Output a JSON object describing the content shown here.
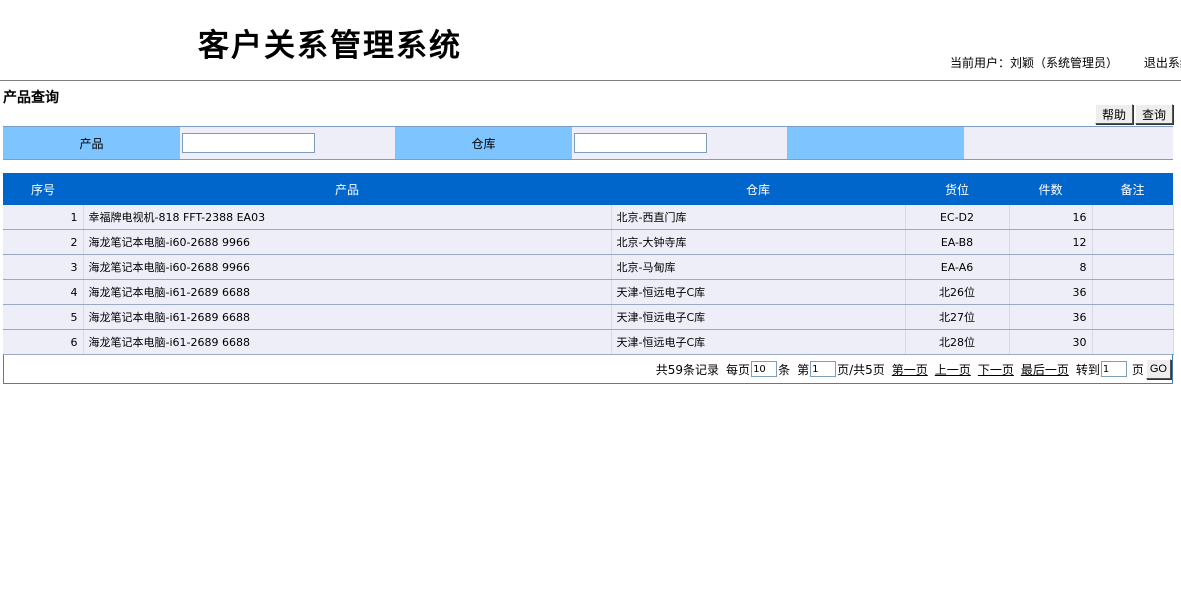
{
  "app": {
    "title": "客户关系管理系统",
    "current_user": "当前用户：刘颖（系统管理员）",
    "logout": "退出系统"
  },
  "page": {
    "title": "产品查询"
  },
  "toolbar": {
    "help_label": "帮助",
    "query_label": "查询"
  },
  "search": {
    "product_label": "产品",
    "product_value": "",
    "warehouse_label": "仓库",
    "warehouse_value": ""
  },
  "table": {
    "headers": [
      "序号",
      "产品",
      "仓库",
      "货位",
      "件数",
      "备注"
    ],
    "rows": [
      [
        "1",
        "幸福牌电视机-818 FFT-2388 EA03",
        "北京-西直门库",
        "EC-D2",
        "16",
        ""
      ],
      [
        "2",
        "海龙笔记本电脑-i60-2688 9966",
        "北京-大钟寺库",
        "EA-B8",
        "12",
        ""
      ],
      [
        "3",
        "海龙笔记本电脑-i60-2688 9966",
        "北京-马甸库",
        "EA-A6",
        "8",
        ""
      ],
      [
        "4",
        "海龙笔记本电脑-i61-2689 6688",
        "天津-恒远电子C库",
        "北26位",
        "36",
        ""
      ],
      [
        "5",
        "海龙笔记本电脑-i61-2689 6688",
        "天津-恒远电子C库",
        "北27位",
        "36",
        ""
      ],
      [
        "6",
        "海龙笔记本电脑-i61-2689 6688",
        "天津-恒远电子C库",
        "北28位",
        "30",
        ""
      ]
    ]
  },
  "pager": {
    "total": "共59条记录",
    "per_page_prefix": "每页",
    "per_page_value": "10",
    "per_page_suffix": "条",
    "page_prefix": "第",
    "page_value": "1",
    "page_suffix": "页/共5页",
    "first": "第一页",
    "prev": "上一页",
    "next": "下一页",
    "last": "最后一页",
    "goto_prefix": "转到",
    "goto_value": "1",
    "goto_suffix": "页",
    "go_label": "GO"
  }
}
